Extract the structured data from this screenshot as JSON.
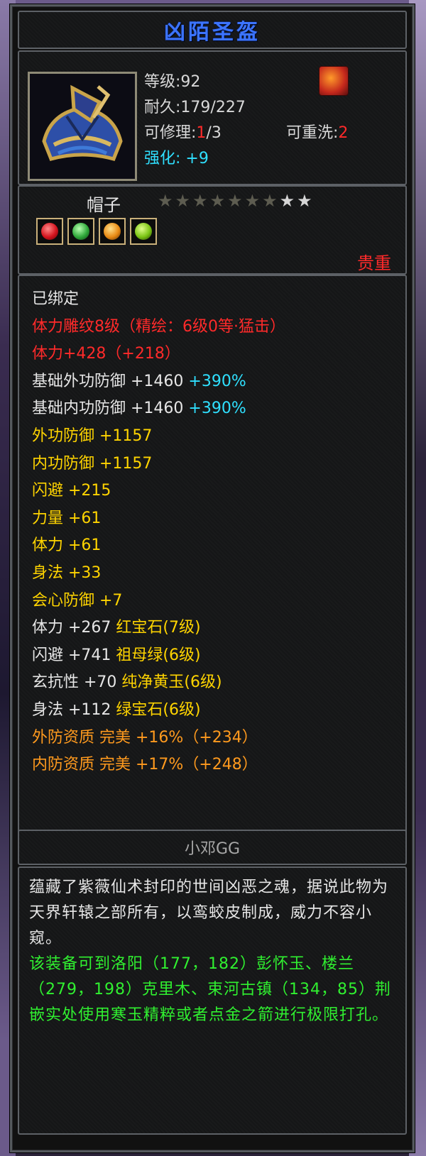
{
  "item": {
    "name": "凶陌圣盔",
    "level_label": "等级:",
    "level": "92",
    "durability_label": "耐久:",
    "durability": "179/227",
    "repairable_label": "可修理:",
    "repairable_current": "1",
    "repairable_max": "/3",
    "rewash_label": "可重洗:",
    "rewash": "2",
    "enhance_label": "强化:",
    "enhance": "+9",
    "type": "帽子",
    "stars_total": 9,
    "stars_lit": 2,
    "gems": [
      "ruby-gem-icon",
      "emerald-gem-icon",
      "topaz-gem-icon",
      "jade-gem-icon"
    ],
    "rarity": "贵重"
  },
  "attributes": [
    {
      "segments": [
        {
          "t": "已绑定",
          "c": "w"
        }
      ]
    },
    {
      "segments": [
        {
          "t": "体力雕纹8级（精绘：6级0等·猛击）",
          "c": "r"
        }
      ]
    },
    {
      "segments": [
        {
          "t": "体力+428（+218）",
          "c": "r"
        }
      ]
    },
    {
      "segments": [
        {
          "t": "基础外功防御 +1460 ",
          "c": "w"
        },
        {
          "t": "+390%",
          "c": "cy"
        }
      ]
    },
    {
      "segments": [
        {
          "t": "基础内功防御 +1460 ",
          "c": "w"
        },
        {
          "t": "+390%",
          "c": "cy"
        }
      ]
    },
    {
      "segments": [
        {
          "t": "外功防御 +1157",
          "c": "y"
        }
      ]
    },
    {
      "segments": [
        {
          "t": "内功防御 +1157",
          "c": "y"
        }
      ]
    },
    {
      "segments": [
        {
          "t": "闪避 +215",
          "c": "y"
        }
      ]
    },
    {
      "segments": [
        {
          "t": "力量 +61",
          "c": "y"
        }
      ]
    },
    {
      "segments": [
        {
          "t": "体力 +61",
          "c": "y"
        }
      ]
    },
    {
      "segments": [
        {
          "t": "身法 +33",
          "c": "y"
        }
      ]
    },
    {
      "segments": [
        {
          "t": "会心防御 +7",
          "c": "y"
        }
      ]
    },
    {
      "segments": [
        {
          "t": "体力 +267 ",
          "c": "w"
        },
        {
          "t": "红宝石(7级)",
          "c": "y"
        }
      ]
    },
    {
      "segments": [
        {
          "t": "闪避 +741 ",
          "c": "w"
        },
        {
          "t": "祖母绿(6级)",
          "c": "y"
        }
      ]
    },
    {
      "segments": [
        {
          "t": "玄抗性 +70 ",
          "c": "w"
        },
        {
          "t": "纯净黄玉(6级)",
          "c": "y"
        }
      ]
    },
    {
      "segments": [
        {
          "t": "身法 +112 ",
          "c": "w"
        },
        {
          "t": "绿宝石(6级)",
          "c": "y"
        }
      ]
    },
    {
      "segments": [
        {
          "t": "外防资质  完美 +16%（+234）",
          "c": "o"
        }
      ]
    },
    {
      "segments": [
        {
          "t": "内防资质  完美 +17%（+248）",
          "c": "o"
        }
      ]
    }
  ],
  "creator": "小邓GG",
  "description": {
    "lore": "蕴藏了紫薇仙术封印的世间凶恶之魂，据说此物为天界轩辕之部所有，以鸾蛟皮制成，威力不容小窥。",
    "hint": "该装备可到洛阳（177，182）彭怀玉、楼兰（279，198）克里木、束河古镇（134，85）荆嵌实处使用寒玉精粹或者点金之箭进行极限打孔。"
  }
}
